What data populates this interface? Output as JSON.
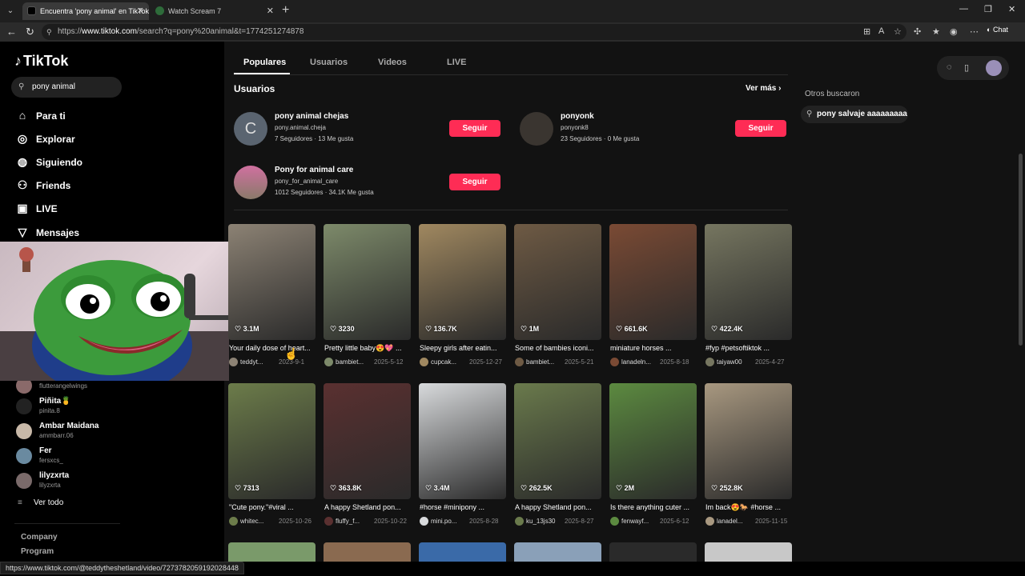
{
  "browser": {
    "tabs": [
      {
        "title": "Encuentra 'pony animal' en TikTok",
        "active": true
      },
      {
        "title": "Watch Scream 7",
        "active": false
      }
    ],
    "url_prefix": "https://",
    "url_host": "www.tiktok.com",
    "url_path": "/search?q=pony%20animal&t=1774251274878",
    "chat_label": "Chat",
    "status_url": "https://www.tiktok.com/@teddytheshetland/video/7273782059192028448"
  },
  "sidebar": {
    "logo": "TikTok",
    "search_value": "pony animal",
    "nav": [
      {
        "label": "Para ti",
        "icon": "home-icon"
      },
      {
        "label": "Explorar",
        "icon": "compass-icon"
      },
      {
        "label": "Siguiendo",
        "icon": "following-icon"
      },
      {
        "label": "Friends",
        "icon": "friends-icon"
      },
      {
        "label": "LIVE",
        "icon": "live-icon"
      },
      {
        "label": "Mensajes",
        "icon": "message-icon"
      }
    ],
    "following": [
      {
        "name": "",
        "handle": "flutterangelwings"
      },
      {
        "name": "Piñita🍍",
        "handle": "pinita.8"
      },
      {
        "name": "Ambar Maidana",
        "handle": "ammbarr.06"
      },
      {
        "name": "Fer",
        "handle": "fersxcs_"
      },
      {
        "name": "lilyzxrta",
        "handle": "lilyzxrta"
      }
    ],
    "see_all": "Ver todo",
    "footer": [
      "Company",
      "Program"
    ]
  },
  "main": {
    "tabs": [
      "Populares",
      "Usuarios",
      "Videos",
      "LIVE"
    ],
    "users_title": "Usuarios",
    "see_more": "Ver más",
    "follow_label": "Seguir",
    "users": [
      {
        "name": "pony animal chejas",
        "handle": "pony.animal.cheja",
        "stats": "7 Seguidores · 13 Me gusta",
        "initial": "C"
      },
      {
        "name": "ponyonk",
        "handle": "ponyonk8",
        "stats": "23 Seguidores · 0 Me gusta",
        "initial": ""
      },
      {
        "name": "Pony for animal care",
        "handle": "pony_for_animal_care",
        "stats": "1012 Seguidores · 34.1K Me gusta",
        "initial": ""
      }
    ],
    "videos": [
      {
        "likes": "3.1M",
        "caption": "Your daily dose of heart...",
        "author": "teddyt...",
        "date": "2023-9-1",
        "thumb": "#8c8274"
      },
      {
        "likes": "3230",
        "caption": "Pretty little baby😍💖 ...",
        "author": "bambiet...",
        "date": "2025-5-12",
        "thumb": "#7d8a6a"
      },
      {
        "likes": "136.7K",
        "caption": "Sleepy girls after eatin...",
        "author": "cupcak...",
        "date": "2025-12-27",
        "thumb": "#a08860"
      },
      {
        "likes": "1M",
        "caption": "Some of bambies iconi...",
        "author": "bambiet...",
        "date": "2025-5-21",
        "thumb": "#6e5a44"
      },
      {
        "likes": "661.6K",
        "caption": "miniature horses ...",
        "author": "lanadeln...",
        "date": "2025-8-18",
        "thumb": "#7a4a34"
      },
      {
        "likes": "422.4K",
        "caption": "#fyp #petsoftiktok ...",
        "author": "taiyaw00",
        "date": "2025-4-27",
        "thumb": "#767660"
      },
      {
        "likes": "7313",
        "caption": "\"Cute pony.\"#viral ...",
        "author": "whitec...",
        "date": "2025-10-26",
        "thumb": "#6c7c4a"
      },
      {
        "likes": "363.8K",
        "caption": "A happy Shetland pon...",
        "author": "fluffy_f...",
        "date": "2025-10-22",
        "thumb": "#5a3030"
      },
      {
        "likes": "3.4M",
        "caption": "#horse #minipony ...",
        "author": "mini.po...",
        "date": "2025-8-28",
        "thumb": "#d8dadc"
      },
      {
        "likes": "262.5K",
        "caption": "A happy Shetland pon...",
        "author": "ku_13js30",
        "date": "2025-8-27",
        "thumb": "#6a7a4c"
      },
      {
        "likes": "2M",
        "caption": "Is there anything cuter ...",
        "author": "fenwayf...",
        "date": "2025-6-12",
        "thumb": "#5c8a40"
      },
      {
        "likes": "252.8K",
        "caption": "Im back😍🐎 #horse ...",
        "author": "lanadel...",
        "date": "2025-11-15",
        "thumb": "#a89880"
      }
    ],
    "row3_thumbs": [
      "#7a9a6a",
      "#8a6a50",
      "#3a6aa8",
      "#8aa0b8",
      "#2a2a2a",
      "#c8c8c8"
    ]
  },
  "right": {
    "others_title": "Otros buscaron",
    "suggestion": "pony salvaje aaaaaaaaa"
  }
}
